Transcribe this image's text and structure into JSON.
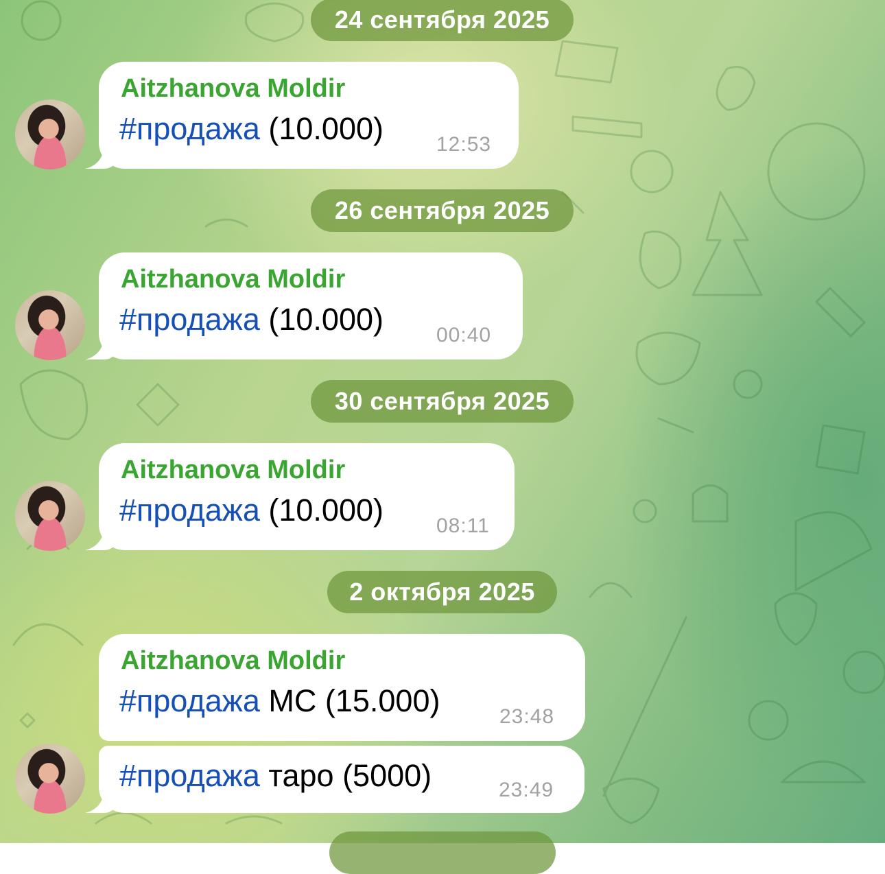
{
  "chat": {
    "dates": [
      "24 сентября 2025",
      "26 сентября 2025",
      "30 сентября 2025",
      "2 октября 2025"
    ],
    "messages": [
      {
        "sender": "Aitzhanova Moldir",
        "hashtag": "#продажа",
        "text": " (10.000)",
        "time": "12:53"
      },
      {
        "sender": "Aitzhanova Moldir",
        "hashtag": "#продажа",
        "text": " (10.000)",
        "time": "00:40"
      },
      {
        "sender": "Aitzhanova Moldir",
        "hashtag": "#продажа",
        "text": " (10.000)",
        "time": "08:11"
      },
      {
        "sender": "Aitzhanova Moldir",
        "hashtag": "#продажа",
        "text": " МС (15.000)",
        "time": "23:48"
      },
      {
        "hashtag": "#продажа",
        "text": " таро (5000)",
        "time": "23:49"
      }
    ]
  },
  "colors": {
    "sender_name": "#3aa531",
    "hashtag": "#1650b5",
    "date_pill": "#6e963c",
    "timestamp": "#a2a2a2"
  }
}
